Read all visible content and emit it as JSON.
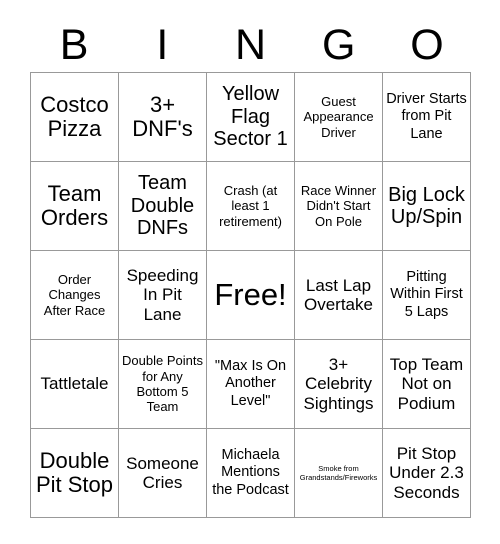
{
  "header": {
    "letters": [
      "B",
      "I",
      "N",
      "G",
      "O"
    ]
  },
  "grid": {
    "rows": [
      [
        {
          "text": "Costco Pizza",
          "size": "xl"
        },
        {
          "text": "3+ DNF's",
          "size": "xl"
        },
        {
          "text": "Yellow Flag Sector 1",
          "size": "lg"
        },
        {
          "text": "Guest Appearance Driver",
          "size": "xs"
        },
        {
          "text": "Driver Starts from Pit Lane",
          "size": "sm"
        }
      ],
      [
        {
          "text": "Team Orders",
          "size": "xl"
        },
        {
          "text": "Team Double DNFs",
          "size": "lg"
        },
        {
          "text": "Crash (at least 1 retirement)",
          "size": "xs"
        },
        {
          "text": "Race Winner Didn't Start On Pole",
          "size": "xs"
        },
        {
          "text": "Big Lock Up/Spin",
          "size": "lg"
        }
      ],
      [
        {
          "text": "Order Changes After Race",
          "size": "xs"
        },
        {
          "text": "Speeding In Pit Lane",
          "size": "md"
        },
        {
          "text": "Free!",
          "size": "xxl"
        },
        {
          "text": "Last Lap Overtake",
          "size": "md"
        },
        {
          "text": "Pitting Within First 5 Laps",
          "size": "sm"
        }
      ],
      [
        {
          "text": "Tattletale",
          "size": "md"
        },
        {
          "text": "Double Points for Any Bottom 5 Team",
          "size": "xs"
        },
        {
          "text": "\"Max Is On Another Level\"",
          "size": "sm"
        },
        {
          "text": "3+ Celebrity Sightings",
          "size": "md"
        },
        {
          "text": "Top Team Not on Podium",
          "size": "md"
        }
      ],
      [
        {
          "text": "Double Pit Stop",
          "size": "xl"
        },
        {
          "text": "Someone Cries",
          "size": "md"
        },
        {
          "text": "Michaela Mentions the Podcast",
          "size": "sm"
        },
        {
          "text": "Smoke from Grandstands/Fireworks",
          "size": "tiny"
        },
        {
          "text": "Pit Stop Under 2.3 Seconds",
          "size": "md"
        }
      ]
    ]
  },
  "colors": {
    "background": "#ffffff",
    "text": "#000000",
    "grid_line": "#999999"
  }
}
